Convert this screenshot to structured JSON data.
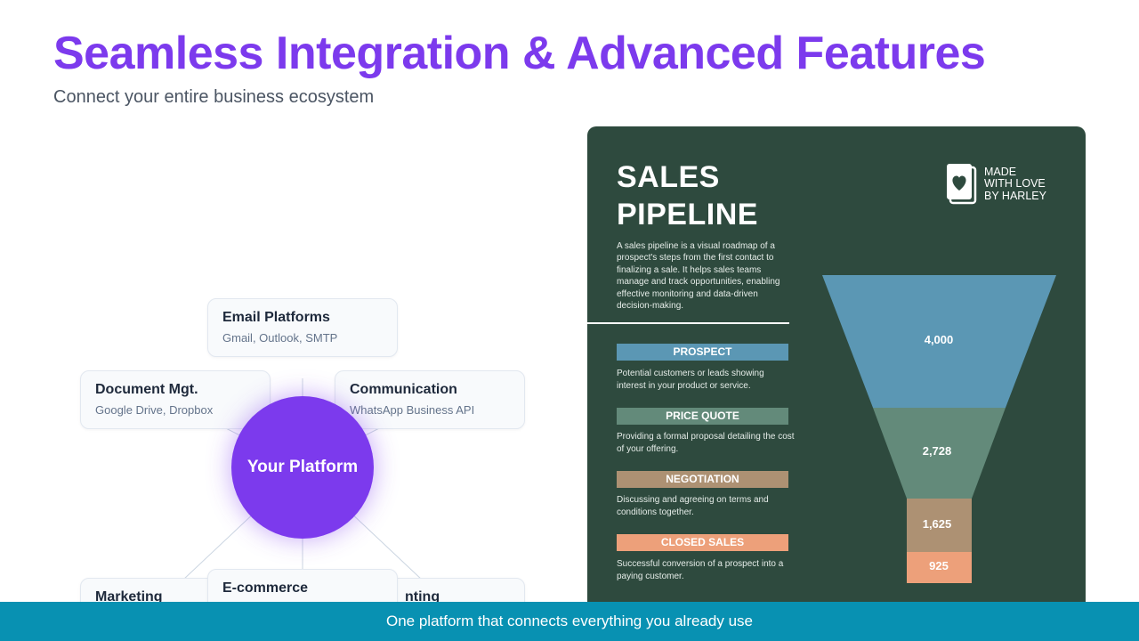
{
  "header": {
    "title": "Seamless Integration & Advanced Features",
    "subtitle": "Connect your entire business ecosystem"
  },
  "hub": {
    "center_label": "Your Platform",
    "nodes": {
      "email": {
        "title": "Email Platforms",
        "sub": "Gmail, Outlook, SMTP"
      },
      "documents": {
        "title": "Document Mgt.",
        "sub": "Google Drive, Dropbox"
      },
      "communication": {
        "title": "Communication",
        "sub": "WhatsApp Business API"
      },
      "marketing": {
        "title": "Marketing"
      },
      "ecommerce": {
        "title": "E-commerce"
      },
      "accounting": {
        "title": "nting"
      }
    }
  },
  "pipeline": {
    "title_line1": "SALES",
    "title_line2": "PIPELINE",
    "description": "A sales pipeline is a visual roadmap of a prospect's steps from the first contact to finalizing a sale. It helps sales teams manage and track opportunities, enabling effective monitoring and data-driven decision-making.",
    "logo_line1": "MADE",
    "logo_line2": "WITH LOVE",
    "logo_line3": "BY HARLEY",
    "stages": [
      {
        "name": "PROSPECT",
        "desc": "Potential customers or leads showing interest in your product or service.",
        "value": "4,000",
        "color": "#5b97b4"
      },
      {
        "name": "PRICE QUOTE",
        "desc": "Providing a formal proposal detailing the cost of your offering.",
        "value": "2,728",
        "color": "#638a7a"
      },
      {
        "name": "NEGOTIATION",
        "desc": "Discussing and agreeing on terms and conditions together.",
        "value": "1,625",
        "color": "#ad9173"
      },
      {
        "name": "CLOSED SALES",
        "desc": "Successful conversion of a prospect into a paying customer.",
        "value": "925",
        "color": "#eda07a"
      }
    ]
  },
  "footer": {
    "text": "One platform that connects everything you already use"
  }
}
